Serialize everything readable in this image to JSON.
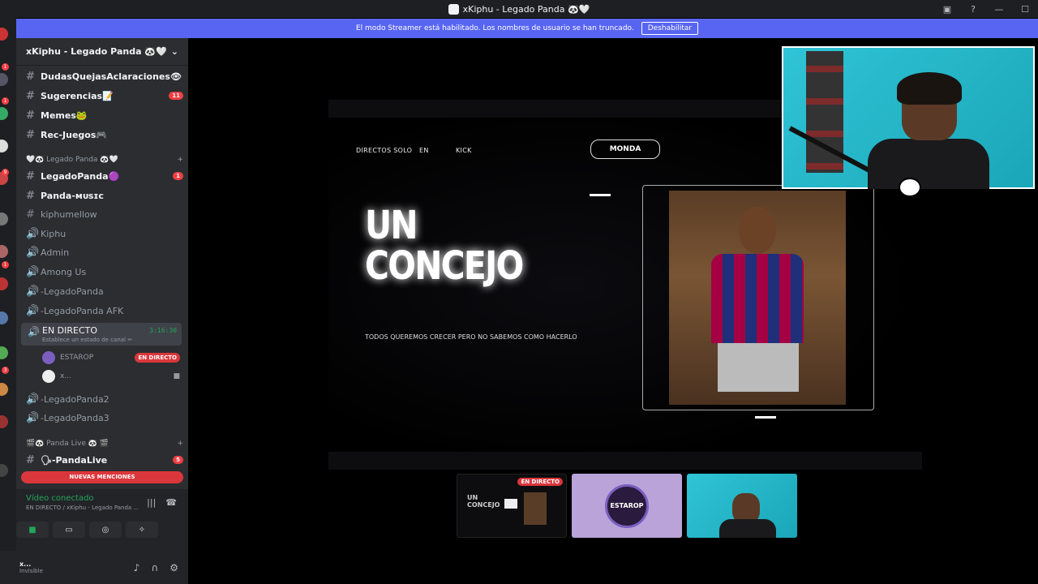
{
  "window": {
    "title": "xKiphu - Legado Panda 🐼🤍",
    "controls": [
      "—",
      "☐"
    ]
  },
  "banner": {
    "text": "El modo Streamer está habilitado. Los nombres de usuario se han truncado.",
    "button": "Deshabilitar"
  },
  "server": {
    "name": "xKiphu - Legado Panda 🐼🤍"
  },
  "channels": [
    {
      "name": "DudasQuejasAclaraciones👁",
      "type": "text",
      "unread": true,
      "count": ""
    },
    {
      "name": "Sugerencias📝",
      "type": "text",
      "unread": true,
      "count": "11"
    },
    {
      "name": "Memes🐸",
      "type": "text",
      "unread": true,
      "count": ""
    },
    {
      "name": "Rec-Juegos🎮",
      "type": "text",
      "unread": true,
      "count": ""
    }
  ],
  "category1": {
    "name": "🤍🐼 Legado Panda 🐼🤍"
  },
  "channels2": [
    {
      "name": "LegadoPanda🟣",
      "type": "text",
      "unread": true,
      "count": "1"
    },
    {
      "name": "Panda-ᴍᴜsɪᴄ",
      "type": "text",
      "unread": true,
      "count": ""
    },
    {
      "name": "kiphumellow",
      "type": "text",
      "unread": false,
      "count": ""
    },
    {
      "name": "Kiphu",
      "type": "voice",
      "unread": false,
      "count": ""
    },
    {
      "name": "Admin",
      "type": "voice",
      "unread": false,
      "count": ""
    },
    {
      "name": "Among Us",
      "type": "voice",
      "unread": false,
      "count": ""
    },
    {
      "name": "-LegadoPanda",
      "type": "voice",
      "unread": false,
      "count": ""
    },
    {
      "name": "-LegadoPanda AFK",
      "type": "voice",
      "unread": false,
      "count": ""
    }
  ],
  "live_channel": {
    "name": "EN DIRECTO",
    "status": "Establece un estado de canal ✏",
    "time": "3:16:30"
  },
  "live_users": [
    {
      "name": "ESTAROP",
      "badge": "EN DIRECTO"
    },
    {
      "name": "x...",
      "badge": ""
    }
  ],
  "channels3": [
    {
      "name": "-LegadoPanda2"
    },
    {
      "name": "-LegadoPanda3"
    }
  ],
  "category2": {
    "name": "🎬🐼 Panda Live 🐼 🎬"
  },
  "channel_pandalive": {
    "name": "🗣-PandaLive",
    "count": "5"
  },
  "mentions": "NUEVAS MENCIONES",
  "voice_panel": {
    "status": "Vídeo conectado",
    "sub": "EN DIRECTO / xKiphu - Legado Panda ..."
  },
  "user_panel": {
    "name": "x...",
    "status": "Invisible"
  },
  "stream": {
    "nav1": "DIRECTOS SOLO",
    "nav2": "EN",
    "nav3": "KICK",
    "pill": "MONDA",
    "title_line1": "UN",
    "title_line2": "CONCEJO",
    "subtitle": "TODOS QUEREMOS CRECER PERO NO SABEMOS COMO HACERLO"
  },
  "thumbnails": [
    {
      "badge": "EN DIRECTO",
      "label": "UN CONCEJO"
    },
    {
      "label": "ESTAROP"
    },
    {
      "label": ""
    }
  ]
}
